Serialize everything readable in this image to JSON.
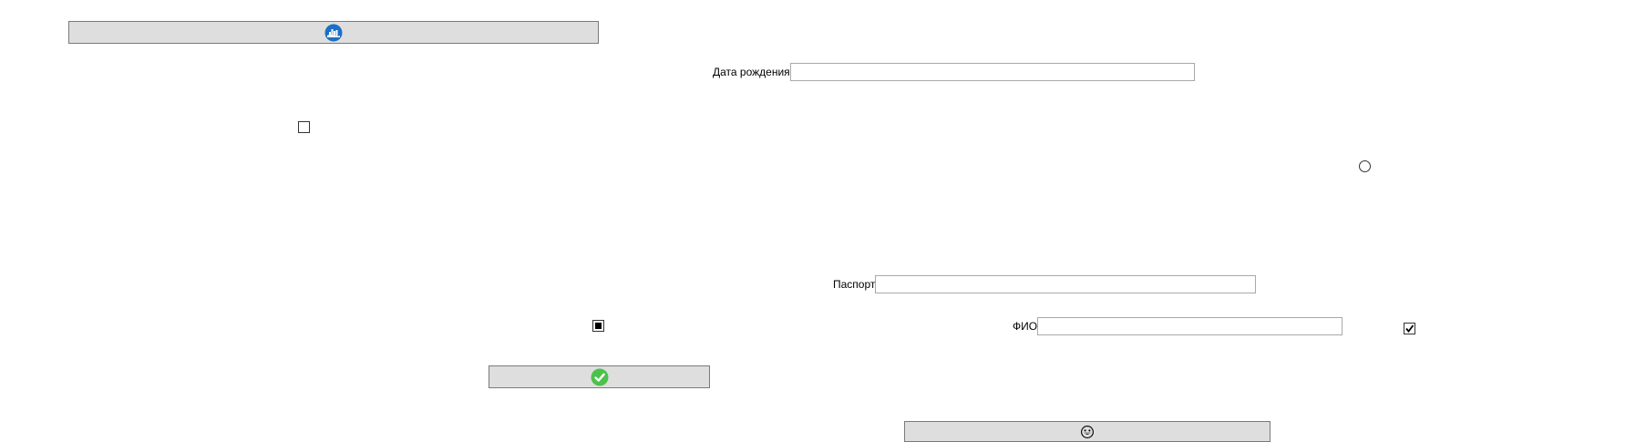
{
  "buttons": {
    "top": {
      "icon": "cloud-city-icon",
      "icon_color": "#1b6fc6"
    },
    "confirm": {
      "icon": "green-check-icon",
      "icon_color": "#4cc24c"
    },
    "bottom": {
      "icon": "smiley-face-icon",
      "icon_color": "#000000"
    }
  },
  "fields": {
    "birth_date": {
      "label": "Дата рождения",
      "value": ""
    },
    "passport": {
      "label": "Паспорт",
      "value": ""
    },
    "full_name": {
      "label": "ФИО",
      "value": ""
    }
  },
  "checkboxes": {
    "unchecked_state": "unchecked",
    "indeterminate_state": "indeterminate",
    "checked_state": "checked"
  },
  "radio": {
    "state": "unselected"
  },
  "colors": {
    "button_bg": "#dedede",
    "button_border": "#7a7a7a",
    "input_border": "#a9a9a9"
  }
}
